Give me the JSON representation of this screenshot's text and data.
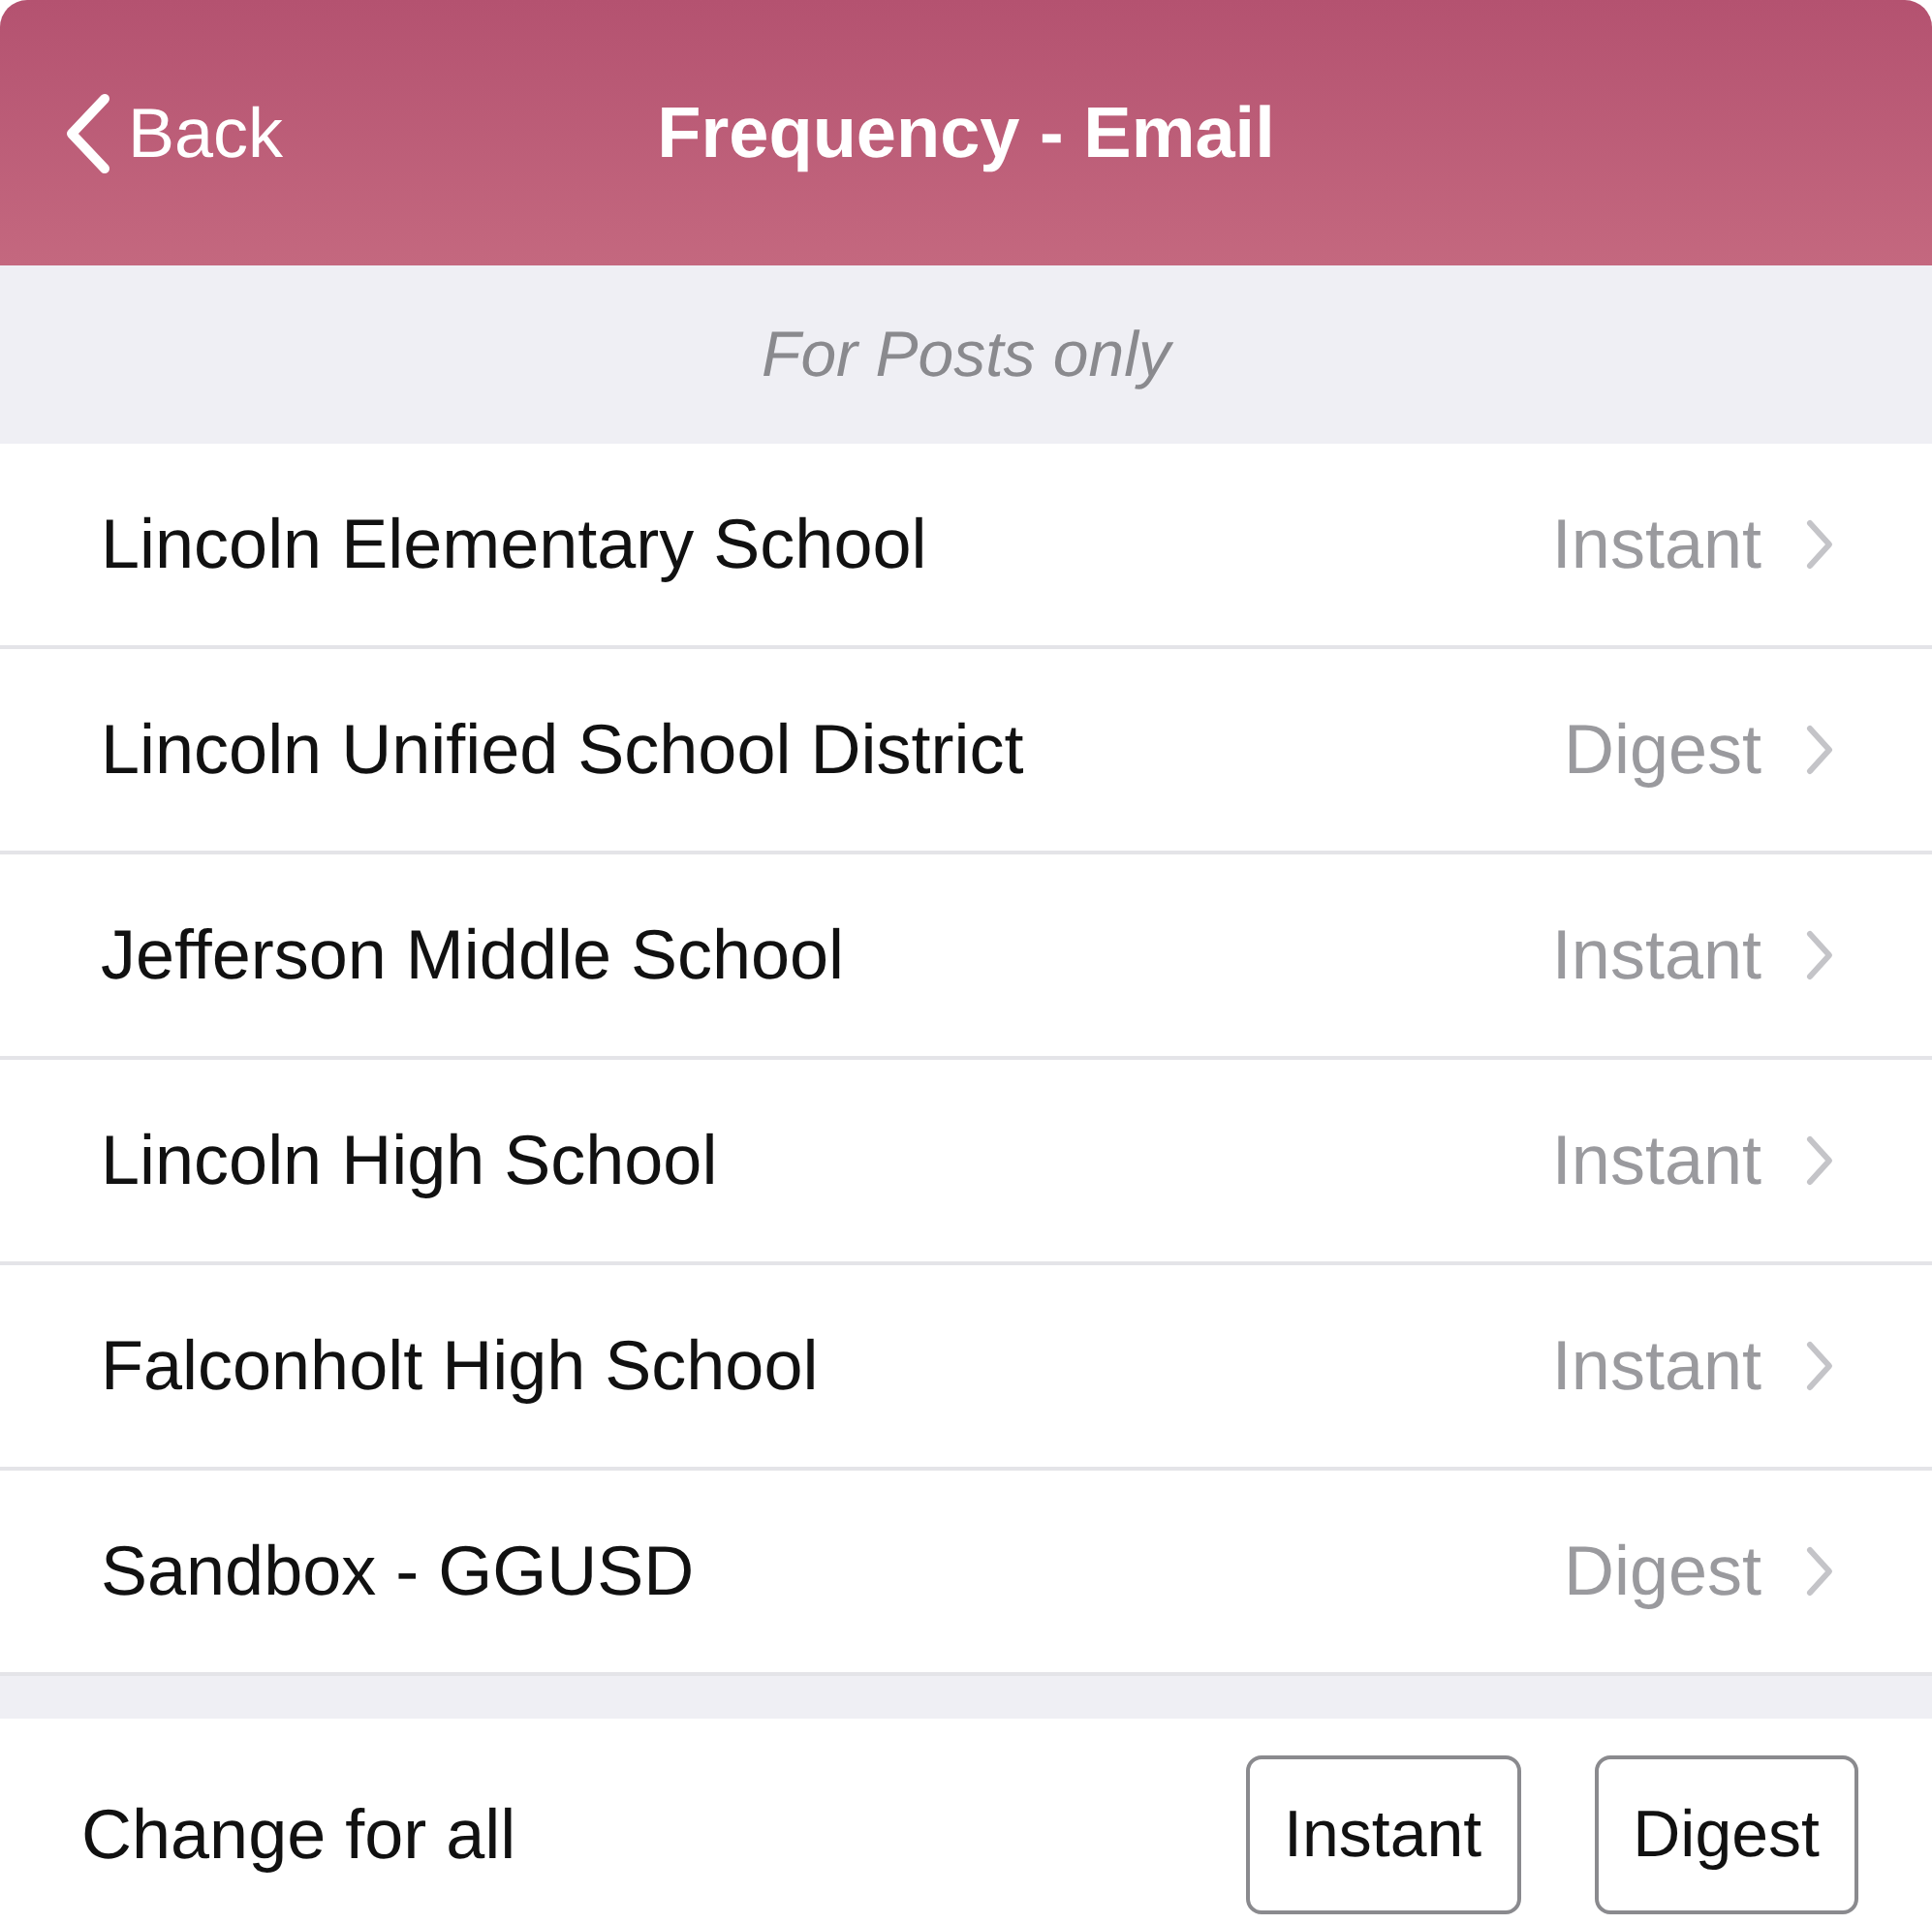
{
  "nav_bar": {
    "back": "Back",
    "title": "Frequency - Email"
  },
  "section_header": "For Posts only",
  "rows": [
    {
      "name": "Lincoln Elementary School",
      "value": "Instant"
    },
    {
      "name": "Lincoln Unified School District",
      "value": "Digest"
    },
    {
      "name": "Jefferson Middle School",
      "value": "Instant"
    },
    {
      "name": "Lincoln High School",
      "value": "Instant"
    },
    {
      "name": "Falconholt High School",
      "value": "Instant"
    },
    {
      "name": "Sandbox - GGUSD",
      "value": "Digest"
    }
  ],
  "footer": {
    "label": "Change for all",
    "buttons": [
      "Instant",
      "Digest"
    ]
  }
}
